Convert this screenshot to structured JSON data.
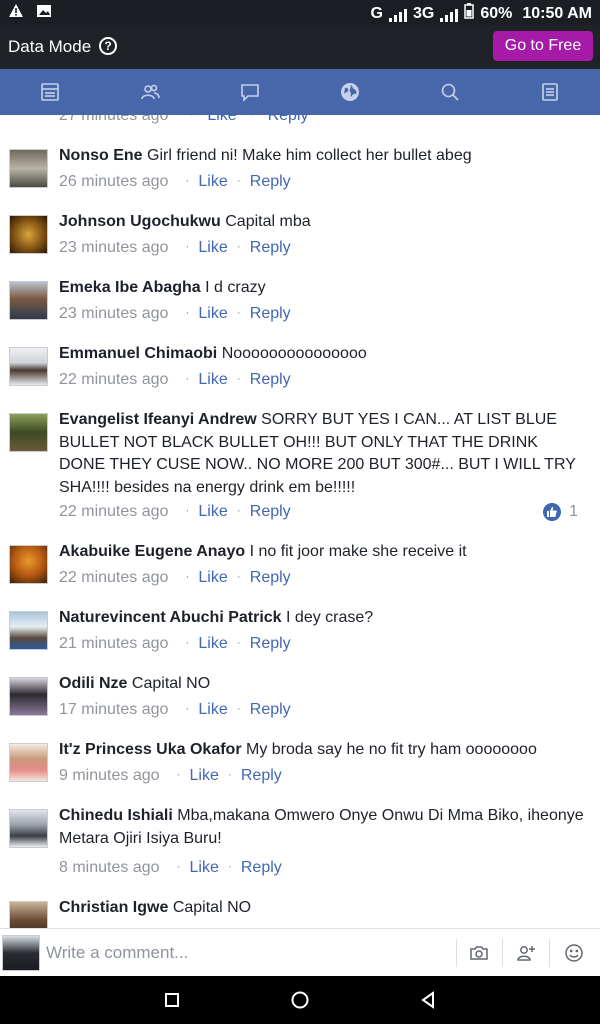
{
  "status_bar": {
    "network_letter": "G",
    "network_type": "3G",
    "battery": "60%",
    "time": "10:50 AM",
    "icons": [
      "warning-icon",
      "gallery-icon",
      "signal-icon",
      "battery-icon"
    ]
  },
  "data_bar": {
    "label": "Data Mode",
    "help_symbol": "?",
    "go_button": "Go to Free"
  },
  "nav": {
    "items": [
      "news-feed-icon",
      "friends-icon",
      "messages-icon",
      "notifications-globe-icon",
      "search-icon",
      "menu-icon"
    ]
  },
  "actions": {
    "like": "Like",
    "reply": "Reply",
    "separator": "·"
  },
  "partial_top": {
    "time": "27 minutes ago"
  },
  "comments": [
    {
      "name": "Nonso Ene",
      "text": "Girl friend ni! Make him collect her bullet abeg",
      "time": "26 minutes ago"
    },
    {
      "name": "Johnson Ugochukwu",
      "text": "Capital mba",
      "time": "23 minutes ago"
    },
    {
      "name": "Emeka Ibe Abagha",
      "text": "I d crazy",
      "time": "23 minutes ago"
    },
    {
      "name": "Emmanuel Chimaobi",
      "text": "Nooooooooooooooo",
      "time": "22 minutes ago"
    },
    {
      "name": "Evangelist Ifeanyi Andrew",
      "text": "SORRY BUT YES I CAN... AT LIST BLUE BULLET NOT BLACK BULLET OH!!! BUT ONLY THAT THE DRINK DONE THEY CUSE NOW.. NO MORE 200 BUT 300#... BUT I WILL TRY SHA!!!!  besides na energy drink em be!!!!!",
      "time": "22 minutes ago",
      "reactions": "1"
    },
    {
      "name": "Akabuike Eugene Anayo",
      "text": "I no fit joor make she receive it",
      "time": "22 minutes ago"
    },
    {
      "name": "Naturevincent Abuchi Patrick",
      "text": "I dey crase?",
      "time": "21 minutes ago"
    },
    {
      "name": "Odili Nze",
      "text": "Capital NO",
      "time": "17 minutes ago"
    },
    {
      "name": "It'z Princess Uka Okafor",
      "text": "My broda say he no fit try ham oooooooo",
      "time": "9 minutes ago"
    },
    {
      "name": "Chinedu Ishiali",
      "text": "Mba,makana Omwero  Onye Onwu Di Mma Biko, iheonye Metara Ojiri Isiya Buru!",
      "time": "8 minutes ago"
    },
    {
      "name": "Christian Igwe",
      "text": "Capital NO",
      "time": ""
    }
  ],
  "composer": {
    "placeholder": "Write a comment...",
    "icons": [
      "camera-icon",
      "add-friend-icon",
      "emoji-icon"
    ]
  },
  "system_nav": [
    "recents-button",
    "home-button",
    "back-button"
  ]
}
